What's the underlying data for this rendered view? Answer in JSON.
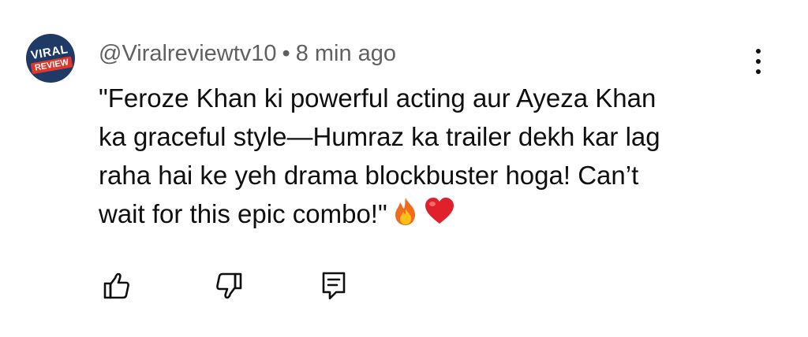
{
  "comment": {
    "avatar": {
      "line1": "VIRAL",
      "line2": "REVIEW"
    },
    "author": "@Viralreviewtv10",
    "separator": "•",
    "time": "8 min ago",
    "text_lines": [
      "\"Feroze Khan ki powerful acting aur Ayeza Khan",
      "ka graceful style—Humraz ka trailer dekh kar lag",
      "raha hai ke yeh drama blockbuster hoga! Can’t",
      "wait for this epic combo!\""
    ],
    "emojis": [
      "fire-emoji",
      "red-heart-emoji"
    ],
    "more_icon": "vertical-ellipsis-icon",
    "actions": [
      "like-icon",
      "dislike-icon",
      "reply-icon"
    ]
  }
}
